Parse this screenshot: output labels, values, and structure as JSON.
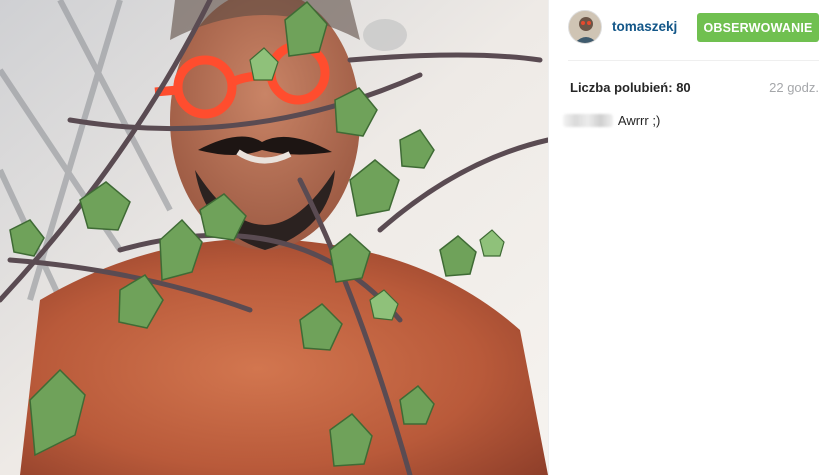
{
  "post": {
    "image_subject": "photo",
    "author": {
      "username": "tomaszekj",
      "avatar_icon": "avatar-icon"
    },
    "follow_button_label": "OBSERWOWANIE",
    "likes_label": "Liczba polubień:",
    "likes_count": "80",
    "time_ago": "22 godz.",
    "caption": {
      "text": "Awrrr ;)"
    }
  },
  "colors": {
    "username": "#125688",
    "follow_button": "#70c050",
    "time": "#a5a7aa",
    "text": "#262626"
  }
}
